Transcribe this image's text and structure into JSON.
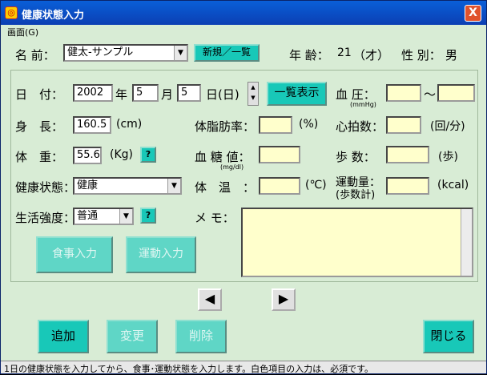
{
  "window": {
    "title": "健康状態入力",
    "close_glyph": "X"
  },
  "menu": {
    "screen": "画面(G)"
  },
  "header": {
    "name_label": "名 前：",
    "name_value": "健太-サンプル",
    "new_list_button": "新規／一覧",
    "age_label": "年 齢：",
    "age_value": "21",
    "age_unit": "（才）",
    "sex_label": "性 別：",
    "sex_value": "男"
  },
  "date": {
    "label": "日　付：",
    "year": "2002",
    "year_unit": "年",
    "month": "5",
    "month_unit": "月",
    "day": "5",
    "day_unit": "日(日)",
    "list_button": "一覧表示"
  },
  "fields": {
    "height_label": "身　長：",
    "height_value": "160.5",
    "height_unit": "(cm)",
    "weight_label": "体　重：",
    "weight_value": "55.6",
    "weight_unit": "(Kg)",
    "health_label": "健康状態：",
    "health_value": "健康",
    "activity_label": "生活強度：",
    "activity_value": "普通",
    "bloodpressure_label": "血 圧：",
    "bloodpressure_sub": "(mmHg)",
    "bloodpressure_sep": "～",
    "bodyfat_label": "体脂肪率：",
    "bodyfat_unit": "(%)",
    "heartrate_label": "心拍数：",
    "heartrate_unit": "(回/分)",
    "bloodsugar_label": "血 糖 値：",
    "bloodsugar_sub": "(mg/dl)",
    "steps_label": "歩 数：",
    "steps_unit": "(歩)",
    "temp_label": "体　温　：",
    "temp_unit": "(℃)",
    "exercise_label_1": "運動量：",
    "exercise_label_2": "(歩数計)",
    "exercise_unit": "(kcal)",
    "memo_label": "メ モ：",
    "help_glyph": "?"
  },
  "buttons": {
    "meal_input": "食事入力",
    "exercise_input": "運動入力",
    "add": "追加",
    "change": "変更",
    "delete": "削除",
    "close": "閉じる",
    "prev_glyph": "◀",
    "next_glyph": "▶",
    "dropdown_glyph": "▼",
    "spin_up": "▲",
    "spin_down": "▼"
  },
  "status": {
    "text": "1日の健康状態を入力してから、食事･運動状態を入力します。白色項目の入力は、必須です。"
  }
}
